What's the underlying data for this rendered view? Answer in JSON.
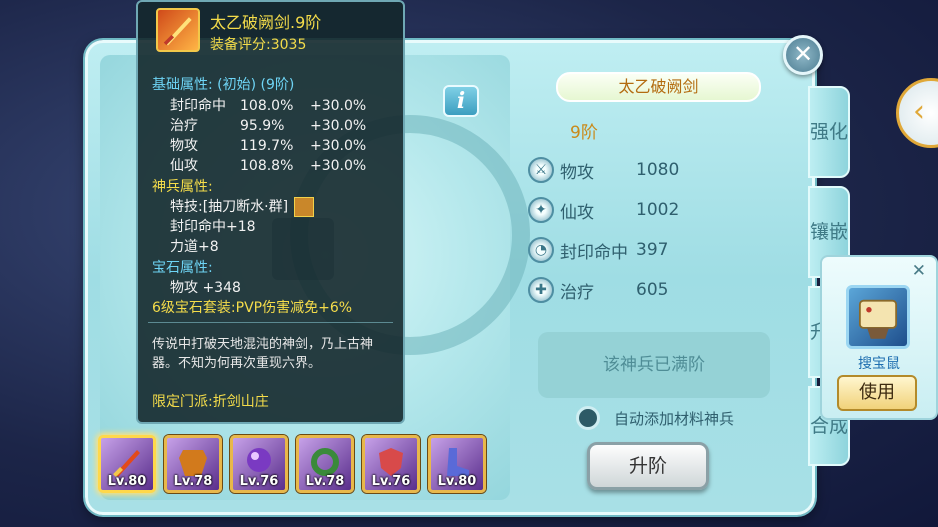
{
  "weapon": {
    "name": "太乙破阙剑",
    "tier": "9阶",
    "stats": [
      {
        "icon": "sword-icon",
        "label": "物攻",
        "value": "1080"
      },
      {
        "icon": "magic-icon",
        "label": "仙攻",
        "value": "1002"
      },
      {
        "icon": "seal-icon",
        "label": "封印命中",
        "value": "397"
      },
      {
        "icon": "heal-icon",
        "label": "治疗",
        "value": "605"
      }
    ],
    "max_text": "该神兵已满阶",
    "auto_add_label": "自动添加材料神兵",
    "upgrade_label": "升阶"
  },
  "info_label": "i",
  "close_label": "✕",
  "tabs": [
    {
      "label": "强化"
    },
    {
      "label": "镶嵌"
    },
    {
      "label": "升阶"
    },
    {
      "label": "合成"
    }
  ],
  "arrow_label": "‹",
  "popup": {
    "close": "✕",
    "item_name": "搜宝鼠",
    "use_label": "使用"
  },
  "slots": [
    {
      "level": "Lv.80",
      "selected": true,
      "color": "#e34a1a"
    },
    {
      "level": "Lv.78",
      "color": "#d27a1c"
    },
    {
      "level": "Lv.76",
      "color": "#7a3ac2"
    },
    {
      "level": "Lv.78",
      "color": "#3a8a3a"
    },
    {
      "level": "Lv.76",
      "color": "#d84a4a"
    },
    {
      "level": "Lv.80",
      "color": "#5a6ad8"
    }
  ],
  "tooltip": {
    "title": "太乙破阙剑.9阶",
    "score": "装备评分:3035",
    "base_header": "基础属性:  (初始)   (9阶)",
    "base_rows": [
      {
        "name": "封印命中",
        "initial": "108.0%",
        "tier": "+30.0%"
      },
      {
        "name": "治疗",
        "initial": "95.9%",
        "tier": "+30.0%"
      },
      {
        "name": "物攻",
        "initial": "119.7%",
        "tier": "+30.0%"
      },
      {
        "name": "仙攻",
        "initial": "108.8%",
        "tier": "+30.0%"
      }
    ],
    "divine_header": "神兵属性:",
    "skill": "特技:[抽刀断水·群]",
    "divine_rows": [
      "封印命中+18",
      "力道+8"
    ],
    "gem_header": "宝石属性:",
    "gem_row": "物攻  +348",
    "gem_set": "6级宝石套装:PVP伤害减免+6%",
    "desc": "传说中打破天地混沌的神剑，乃上古神器。不知为何再次重现六界。",
    "faction": "限定门派:折剑山庄"
  }
}
